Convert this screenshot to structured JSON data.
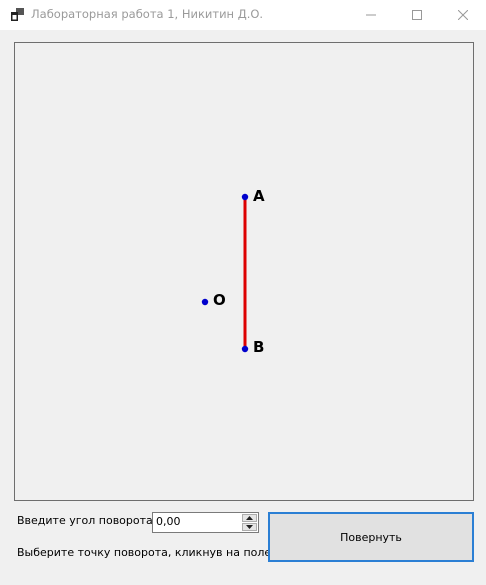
{
  "window": {
    "title": "Лабораторная работа 1, Никитин Д.О."
  },
  "canvas": {
    "points": [
      {
        "label": "A",
        "color": "#0000cc"
      },
      {
        "label": "B",
        "color": "#0000cc"
      },
      {
        "label": "O",
        "color": "#0000cc"
      }
    ],
    "segment_color": "#dd0000"
  },
  "controls": {
    "angle_label": "Введите угол поворота",
    "angle_value": "0,00",
    "hint_label": "Выберите точку поворота, кликнув на поле",
    "rotate_button": "Повернуть"
  },
  "colors": {
    "accent": "#2b7fd4"
  }
}
